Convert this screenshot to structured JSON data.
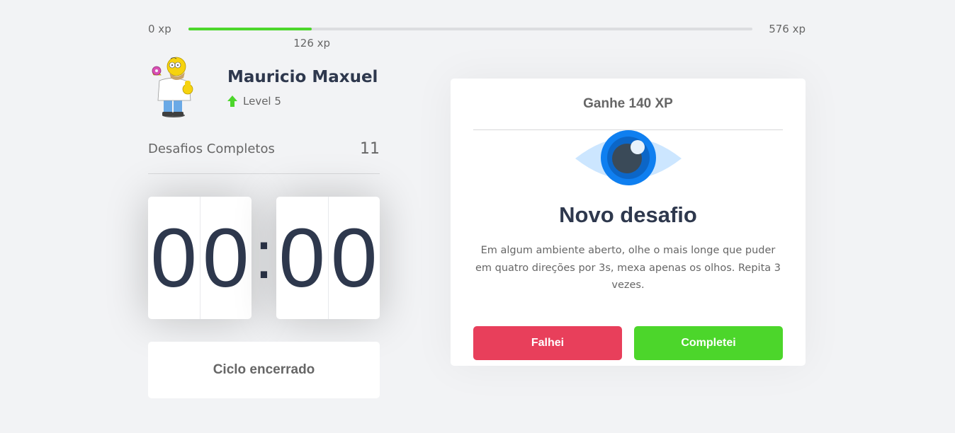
{
  "experience_bar": {
    "min_label": "0 xp",
    "max_label": "576 xp",
    "current_label": "126 xp",
    "current_xp": 126,
    "max_xp": 576,
    "fill_color": "#4cd62b"
  },
  "profile": {
    "name": "Mauricio Maxuel",
    "level_label": "Level 5",
    "avatar_icon": "homer-simpson-avatar",
    "level_icon": "level-up-arrow-icon"
  },
  "completed_challenges": {
    "label": "Desafios Completos",
    "value": "11"
  },
  "countdown": {
    "minute_left": "0",
    "minute_right": "0",
    "separator": ":",
    "second_left": "0",
    "second_right": "0"
  },
  "cycle_button": {
    "label": "Ciclo encerrado"
  },
  "challenge": {
    "header": "Ganhe 140 XP",
    "icon": "eye-icon",
    "title": "Novo desafio",
    "description": "Em algum ambiente aberto, olhe o mais longe que puder em quatro direções por 3s, mexa apenas os olhos. Repita 3 vezes.",
    "fail_label": "Falhei",
    "success_label": "Completei",
    "fail_color": "#e83f5b",
    "success_color": "#4cd62b"
  },
  "colors": {
    "background": "#f2f3f5",
    "title_text": "#2e384d",
    "body_text": "#666666"
  }
}
